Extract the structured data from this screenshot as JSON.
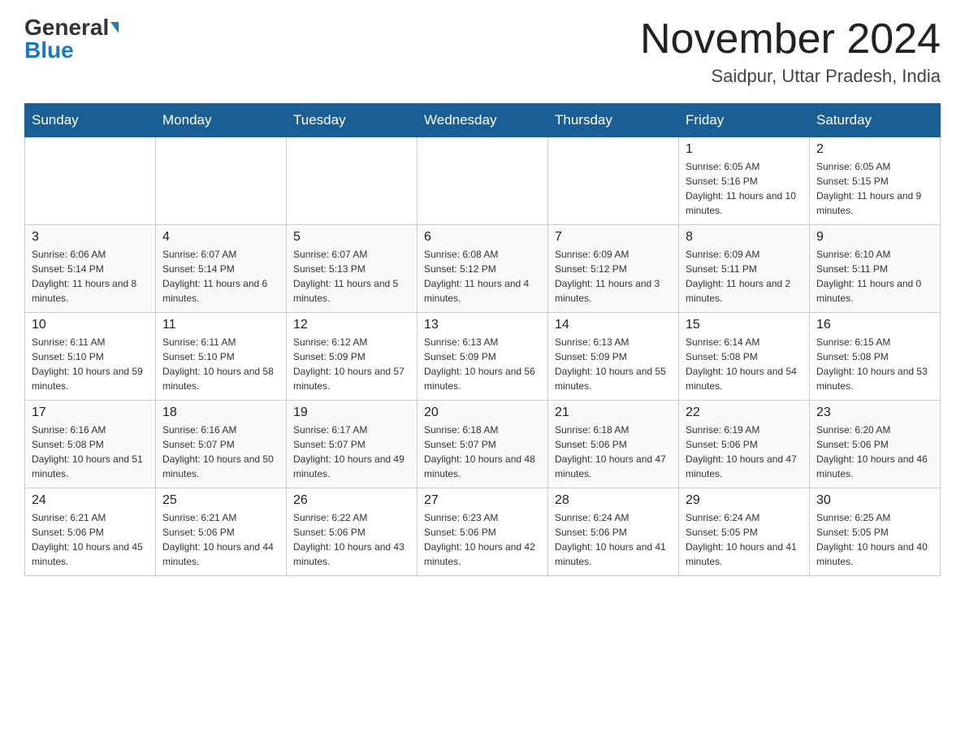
{
  "logo": {
    "general": "General",
    "blue": "Blue"
  },
  "header": {
    "month": "November 2024",
    "location": "Saidpur, Uttar Pradesh, India"
  },
  "weekdays": [
    "Sunday",
    "Monday",
    "Tuesday",
    "Wednesday",
    "Thursday",
    "Friday",
    "Saturday"
  ],
  "weeks": [
    [
      {
        "day": "",
        "info": ""
      },
      {
        "day": "",
        "info": ""
      },
      {
        "day": "",
        "info": ""
      },
      {
        "day": "",
        "info": ""
      },
      {
        "day": "",
        "info": ""
      },
      {
        "day": "1",
        "info": "Sunrise: 6:05 AM\nSunset: 5:16 PM\nDaylight: 11 hours and 10 minutes."
      },
      {
        "day": "2",
        "info": "Sunrise: 6:05 AM\nSunset: 5:15 PM\nDaylight: 11 hours and 9 minutes."
      }
    ],
    [
      {
        "day": "3",
        "info": "Sunrise: 6:06 AM\nSunset: 5:14 PM\nDaylight: 11 hours and 8 minutes."
      },
      {
        "day": "4",
        "info": "Sunrise: 6:07 AM\nSunset: 5:14 PM\nDaylight: 11 hours and 6 minutes."
      },
      {
        "day": "5",
        "info": "Sunrise: 6:07 AM\nSunset: 5:13 PM\nDaylight: 11 hours and 5 minutes."
      },
      {
        "day": "6",
        "info": "Sunrise: 6:08 AM\nSunset: 5:12 PM\nDaylight: 11 hours and 4 minutes."
      },
      {
        "day": "7",
        "info": "Sunrise: 6:09 AM\nSunset: 5:12 PM\nDaylight: 11 hours and 3 minutes."
      },
      {
        "day": "8",
        "info": "Sunrise: 6:09 AM\nSunset: 5:11 PM\nDaylight: 11 hours and 2 minutes."
      },
      {
        "day": "9",
        "info": "Sunrise: 6:10 AM\nSunset: 5:11 PM\nDaylight: 11 hours and 0 minutes."
      }
    ],
    [
      {
        "day": "10",
        "info": "Sunrise: 6:11 AM\nSunset: 5:10 PM\nDaylight: 10 hours and 59 minutes."
      },
      {
        "day": "11",
        "info": "Sunrise: 6:11 AM\nSunset: 5:10 PM\nDaylight: 10 hours and 58 minutes."
      },
      {
        "day": "12",
        "info": "Sunrise: 6:12 AM\nSunset: 5:09 PM\nDaylight: 10 hours and 57 minutes."
      },
      {
        "day": "13",
        "info": "Sunrise: 6:13 AM\nSunset: 5:09 PM\nDaylight: 10 hours and 56 minutes."
      },
      {
        "day": "14",
        "info": "Sunrise: 6:13 AM\nSunset: 5:09 PM\nDaylight: 10 hours and 55 minutes."
      },
      {
        "day": "15",
        "info": "Sunrise: 6:14 AM\nSunset: 5:08 PM\nDaylight: 10 hours and 54 minutes."
      },
      {
        "day": "16",
        "info": "Sunrise: 6:15 AM\nSunset: 5:08 PM\nDaylight: 10 hours and 53 minutes."
      }
    ],
    [
      {
        "day": "17",
        "info": "Sunrise: 6:16 AM\nSunset: 5:08 PM\nDaylight: 10 hours and 51 minutes."
      },
      {
        "day": "18",
        "info": "Sunrise: 6:16 AM\nSunset: 5:07 PM\nDaylight: 10 hours and 50 minutes."
      },
      {
        "day": "19",
        "info": "Sunrise: 6:17 AM\nSunset: 5:07 PM\nDaylight: 10 hours and 49 minutes."
      },
      {
        "day": "20",
        "info": "Sunrise: 6:18 AM\nSunset: 5:07 PM\nDaylight: 10 hours and 48 minutes."
      },
      {
        "day": "21",
        "info": "Sunrise: 6:18 AM\nSunset: 5:06 PM\nDaylight: 10 hours and 47 minutes."
      },
      {
        "day": "22",
        "info": "Sunrise: 6:19 AM\nSunset: 5:06 PM\nDaylight: 10 hours and 47 minutes."
      },
      {
        "day": "23",
        "info": "Sunrise: 6:20 AM\nSunset: 5:06 PM\nDaylight: 10 hours and 46 minutes."
      }
    ],
    [
      {
        "day": "24",
        "info": "Sunrise: 6:21 AM\nSunset: 5:06 PM\nDaylight: 10 hours and 45 minutes."
      },
      {
        "day": "25",
        "info": "Sunrise: 6:21 AM\nSunset: 5:06 PM\nDaylight: 10 hours and 44 minutes."
      },
      {
        "day": "26",
        "info": "Sunrise: 6:22 AM\nSunset: 5:06 PM\nDaylight: 10 hours and 43 minutes."
      },
      {
        "day": "27",
        "info": "Sunrise: 6:23 AM\nSunset: 5:06 PM\nDaylight: 10 hours and 42 minutes."
      },
      {
        "day": "28",
        "info": "Sunrise: 6:24 AM\nSunset: 5:06 PM\nDaylight: 10 hours and 41 minutes."
      },
      {
        "day": "29",
        "info": "Sunrise: 6:24 AM\nSunset: 5:05 PM\nDaylight: 10 hours and 41 minutes."
      },
      {
        "day": "30",
        "info": "Sunrise: 6:25 AM\nSunset: 5:05 PM\nDaylight: 10 hours and 40 minutes."
      }
    ]
  ]
}
